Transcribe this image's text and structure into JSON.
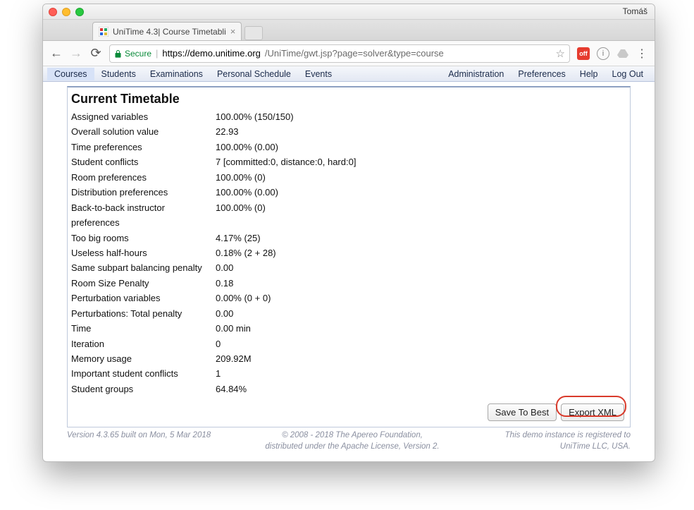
{
  "browser": {
    "profile_name": "Tomáš",
    "tab_title": "UniTime 4.3| Course Timetabli",
    "secure_label": "Secure",
    "url_host": "https://demo.unitime.org",
    "url_path": "/UniTime/gwt.jsp?page=solver&type=course",
    "ext_off_label": "off"
  },
  "menu": {
    "left": [
      "Courses",
      "Students",
      "Examinations",
      "Personal Schedule",
      "Events"
    ],
    "right": [
      "Administration",
      "Preferences",
      "Help",
      "Log Out"
    ],
    "selected": "Courses"
  },
  "panel": {
    "title": "Current Timetable",
    "rows": [
      {
        "label": "Assigned variables",
        "value": "100.00% (150/150)"
      },
      {
        "label": "Overall solution value",
        "value": "22.93"
      },
      {
        "label": "Time preferences",
        "value": "100.00% (0.00)"
      },
      {
        "label": "Student conflicts",
        "value": "7 [committed:0, distance:0, hard:0]"
      },
      {
        "label": "Room preferences",
        "value": "100.00% (0)"
      },
      {
        "label": "Distribution preferences",
        "value": "100.00% (0.00)"
      },
      {
        "label": "Back-to-back instructor preferences",
        "value": "100.00% (0)"
      },
      {
        "label": "Too big rooms",
        "value": "4.17% (25)"
      },
      {
        "label": "Useless half-hours",
        "value": "0.18% (2 + 28)"
      },
      {
        "label": "Same subpart balancing penalty",
        "value": "0.00"
      },
      {
        "label": "Room Size Penalty",
        "value": "0.18"
      },
      {
        "label": "Perturbation variables",
        "value": "0.00% (0 + 0)"
      },
      {
        "label": "Perturbations: Total penalty",
        "value": "0.00"
      },
      {
        "label": "Time",
        "value": "0.00 min"
      },
      {
        "label": "Iteration",
        "value": "0"
      },
      {
        "label": "Memory usage",
        "value": "209.92M"
      },
      {
        "label": "Important student conflicts",
        "value": "1"
      },
      {
        "label": "Student groups",
        "value": "64.84%"
      }
    ],
    "buttons": {
      "save": "Save To Best",
      "export": "Export XML"
    }
  },
  "footer": {
    "version": "Version 4.3.65 built on Mon, 5 Mar 2018",
    "copyright_l1": "© 2008 - 2018 The Apereo Foundation,",
    "copyright_l2": "distributed under the Apache License, Version 2.",
    "registered_l1": "This demo instance is registered to",
    "registered_l2": "UniTime LLC, USA."
  }
}
